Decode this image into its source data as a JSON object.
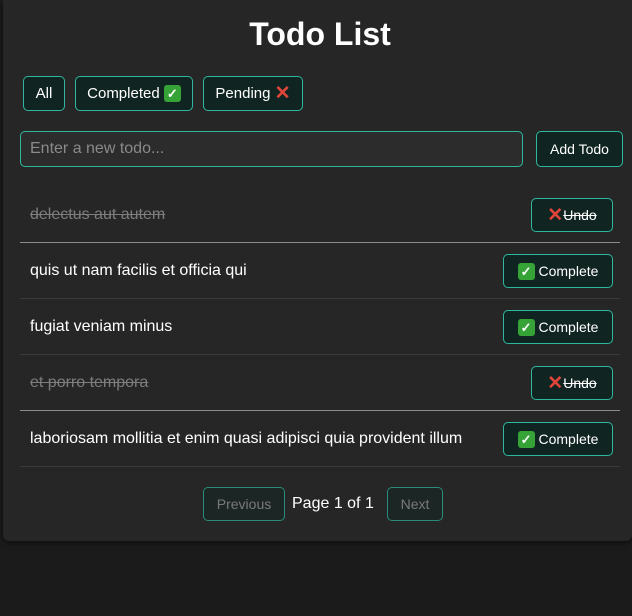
{
  "title": "Todo List",
  "filters": {
    "all": "All",
    "completed": "Completed",
    "pending": "Pending"
  },
  "new_todo": {
    "placeholder": "Enter a new todo...",
    "value": "",
    "add_label": "Add Todo"
  },
  "todos": [
    {
      "text": "delectus aut autem",
      "completed": true,
      "action": "Undo"
    },
    {
      "text": "quis ut nam facilis et officia qui",
      "completed": false,
      "action": "Complete"
    },
    {
      "text": "fugiat veniam minus",
      "completed": false,
      "action": "Complete"
    },
    {
      "text": "et porro tempora",
      "completed": true,
      "action": "Undo"
    },
    {
      "text": "laboriosam mollitia et enim quasi adipisci quia provident illum",
      "completed": false,
      "action": "Complete"
    }
  ],
  "pagination": {
    "previous": "Previous",
    "page_text": "Page 1 of 1",
    "next": "Next"
  },
  "colors": {
    "accent": "#2fb8a0",
    "check": "#36a337",
    "cross": "#e2453a"
  },
  "icons": {
    "completed_filter": "check-mark-icon",
    "pending_filter": "cross-mark-icon",
    "complete_action": "check-mark-icon",
    "undo_action": "cross-mark-icon"
  }
}
